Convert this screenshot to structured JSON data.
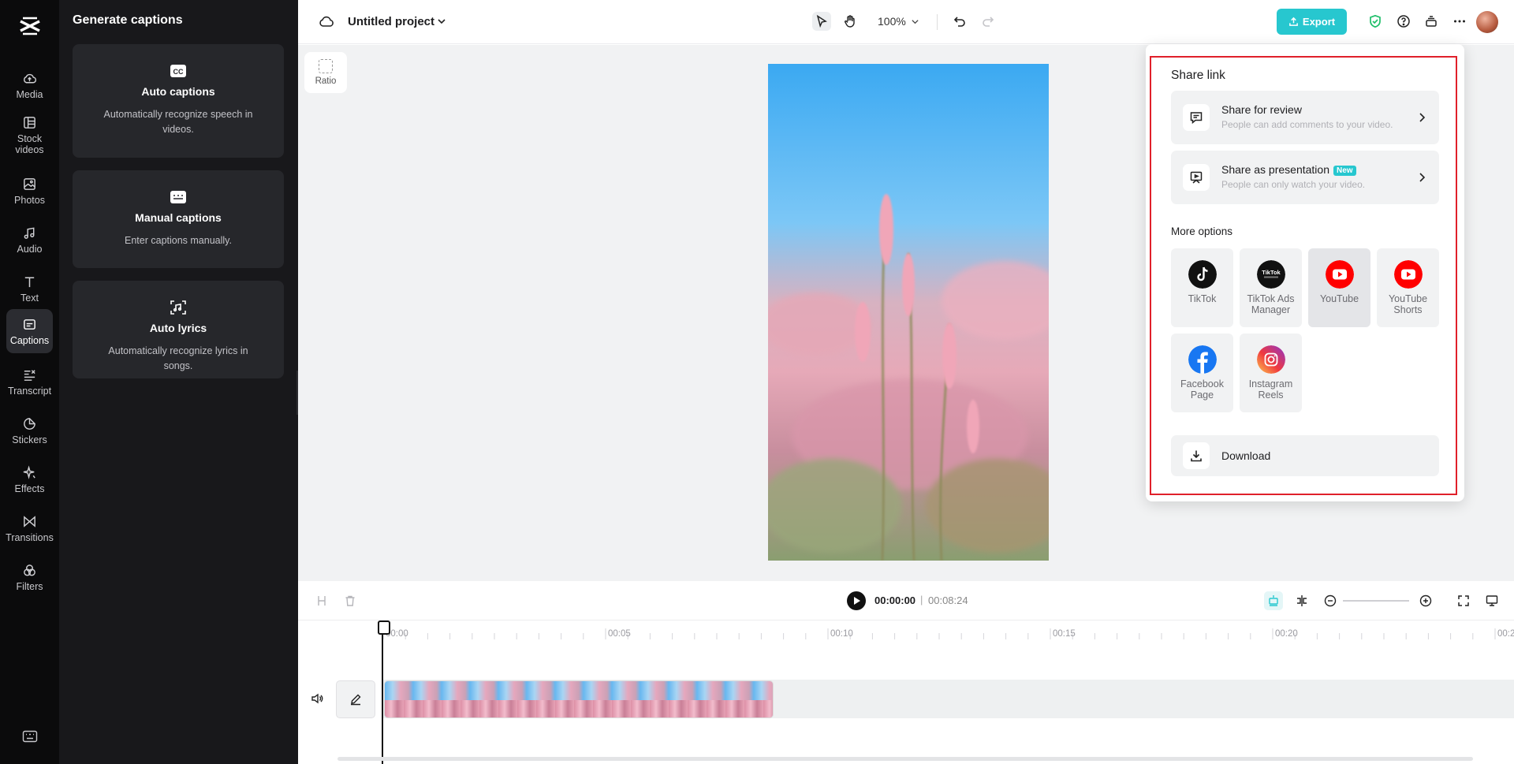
{
  "rail": {
    "items": [
      {
        "label": "Media",
        "icon": "cloud-upload-icon"
      },
      {
        "label": "Stock videos",
        "icon": "film-grid-icon"
      },
      {
        "label": "Photos",
        "icon": "image-icon"
      },
      {
        "label": "Audio",
        "icon": "music-note-icon"
      },
      {
        "label": "Text",
        "icon": "text-t-icon"
      },
      {
        "label": "Captions",
        "icon": "captions-icon"
      },
      {
        "label": "Transcript",
        "icon": "transcript-icon"
      },
      {
        "label": "Stickers",
        "icon": "sticker-icon"
      },
      {
        "label": "Effects",
        "icon": "sparkle-icon"
      },
      {
        "label": "Transitions",
        "icon": "bowtie-icon"
      },
      {
        "label": "Filters",
        "icon": "circles-icon"
      }
    ],
    "active": "Captions"
  },
  "panel": {
    "title": "Generate captions",
    "cards": [
      {
        "title": "Auto captions",
        "desc": "Automatically recognize speech in videos."
      },
      {
        "title": "Manual captions",
        "desc": "Enter captions manually."
      },
      {
        "title": "Auto lyrics",
        "desc": "Automatically recognize lyrics in songs."
      }
    ]
  },
  "topbar": {
    "project": "Untitled project",
    "zoom": "100%",
    "export": "Export"
  },
  "canvas": {
    "ratio": "Ratio"
  },
  "player": {
    "current": "00:00:00",
    "sep": "|",
    "total": "00:08:24"
  },
  "timeline": {
    "ticks": [
      "00:00",
      "00:05",
      "00:10",
      "00:15",
      "00:20",
      "00:2"
    ]
  },
  "share": {
    "heading": "Share link",
    "review_title": "Share for review",
    "review_desc": "People can add comments to your video.",
    "presentation_title": "Share as presentation",
    "presentation_badge": "New",
    "presentation_desc": "People can only watch your video.",
    "more": "More options",
    "options": [
      {
        "label": "TikTok"
      },
      {
        "label": "TikTok Ads Manager"
      },
      {
        "label": "YouTube"
      },
      {
        "label": "YouTube Shorts"
      },
      {
        "label": "Facebook Page"
      },
      {
        "label": "Instagram Reels"
      }
    ],
    "download": "Download"
  },
  "colors": {
    "accent": "#27c7cf",
    "highlight": "#e0202a",
    "youtube": "#ff0000",
    "facebook": "#1877f2"
  }
}
